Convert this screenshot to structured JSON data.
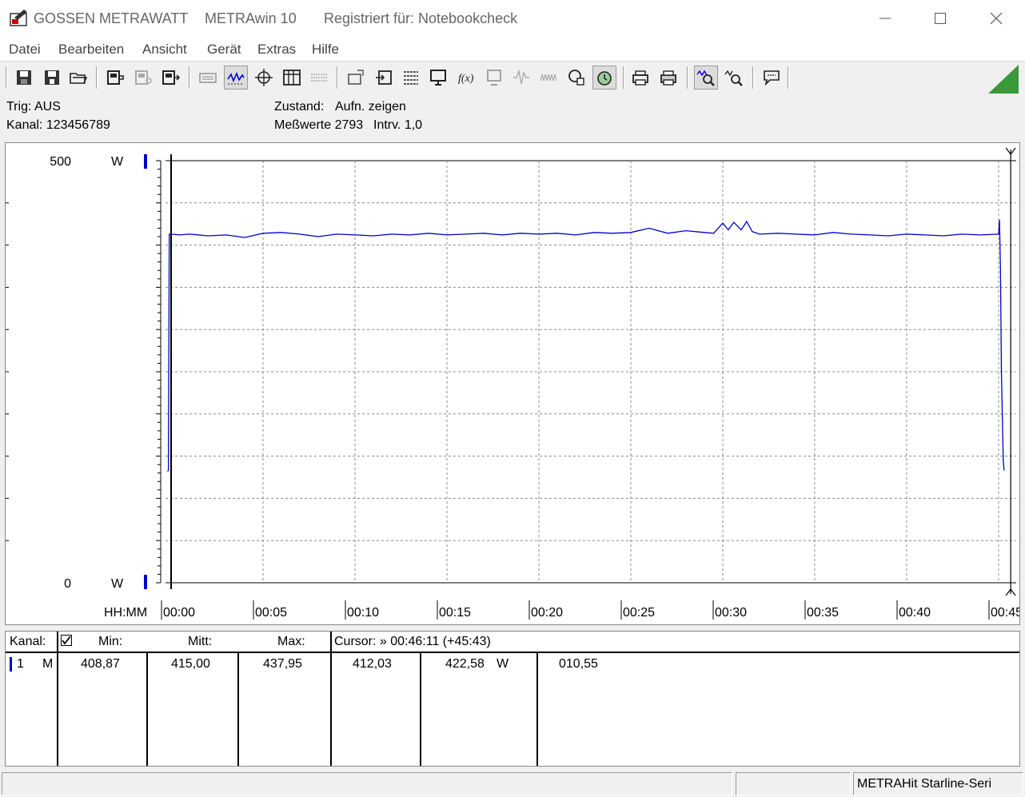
{
  "window": {
    "brand": "GOSSEN METRAWATT",
    "app_name": "METRAwin 10",
    "registration": "Registriert für: Notebookcheck"
  },
  "menu": [
    "Datei",
    "Bearbeiten",
    "Ansicht",
    "Gerät",
    "Extras",
    "Hilfe"
  ],
  "toolbar_icons": [
    "save-icon",
    "save-as-icon",
    "open-folder-icon",
    "device-connect-icon",
    "device-settings-icon",
    "device-export-icon",
    "keyboard-icon",
    "waveform-view-icon",
    "crosshair-icon",
    "table-view-icon",
    "list-view-icon",
    "import-icon",
    "export-data-icon",
    "channel-settings-icon",
    "monitor-icon",
    "formula-icon",
    "display-icon",
    "signal-icon",
    "noise-icon",
    "record-icon",
    "trigger-icon",
    "print-preview-icon",
    "print-icon",
    "zoom-curve-icon",
    "zoom-in-icon",
    "message-icon"
  ],
  "info": {
    "trig_label": "Trig: AUS",
    "kanal_label": "Kanal: 123456789",
    "zustand_label": "Zustand:",
    "zustand_value": "Aufn. zeigen",
    "messwerte_label": "Meßwerte 2793",
    "interval_label": "Intrv. 1,0"
  },
  "chart_data": {
    "type": "line",
    "y_top_label": "500",
    "y_bottom_label": "0",
    "y_unit": "W",
    "x_axis_label": "HH:MM",
    "x_tick_labels": [
      "00:00",
      "00:05",
      "00:10",
      "00:15",
      "00:20",
      "00:25",
      "00:30",
      "00:35",
      "00:40",
      "00:45"
    ],
    "ylim": [
      0,
      500
    ],
    "xlim_minutes": [
      0,
      45.7
    ],
    "grid": true,
    "series": [
      {
        "color": "#0000cc",
        "x_minutes": [
          -0.2,
          -0.15,
          -0.1,
          0.0,
          0.5,
          1,
          2,
          3,
          4,
          5,
          6,
          7,
          8,
          9,
          10,
          11,
          12,
          13,
          14,
          15,
          16,
          17,
          18,
          19,
          20,
          21,
          22,
          23,
          24,
          25,
          26,
          27,
          28,
          29,
          29.5,
          30,
          30.3,
          30.6,
          31,
          31.3,
          31.6,
          32,
          33,
          34,
          35,
          36,
          37,
          38,
          39,
          40,
          41,
          42,
          43,
          44,
          45,
          45.05,
          45.1,
          45.15,
          45.25,
          45.3
        ],
        "values_w": [
          132,
          133,
          413,
          413,
          412,
          413,
          411,
          412,
          409,
          414,
          415,
          413,
          410,
          413,
          412,
          411,
          413,
          412,
          414,
          412,
          413,
          414,
          412,
          414,
          413,
          414,
          412,
          415,
          414,
          415,
          420,
          414,
          417,
          415,
          414,
          426,
          418,
          427,
          418,
          428,
          416,
          413,
          414,
          413,
          412,
          415,
          413,
          412,
          411,
          413,
          412,
          411,
          413,
          412,
          413,
          430,
          372,
          250,
          145,
          133
        ]
      }
    ]
  },
  "table": {
    "headers": {
      "kanal": "Kanal:",
      "min": "Min:",
      "mitt": "Mitt:",
      "max": "Max:",
      "cursor": "Cursor: » 00:46:11 (+45:43)"
    },
    "row": {
      "channel": "1",
      "mode": "M",
      "min": "408,87",
      "mitt": "415,00",
      "max": "437,95",
      "cursor_value": "412,03",
      "value2": "422,58",
      "unit": "W",
      "diff": "010,55",
      "color": "#0000cc"
    }
  },
  "status": {
    "device": "METRAHit Starline-Seri"
  }
}
